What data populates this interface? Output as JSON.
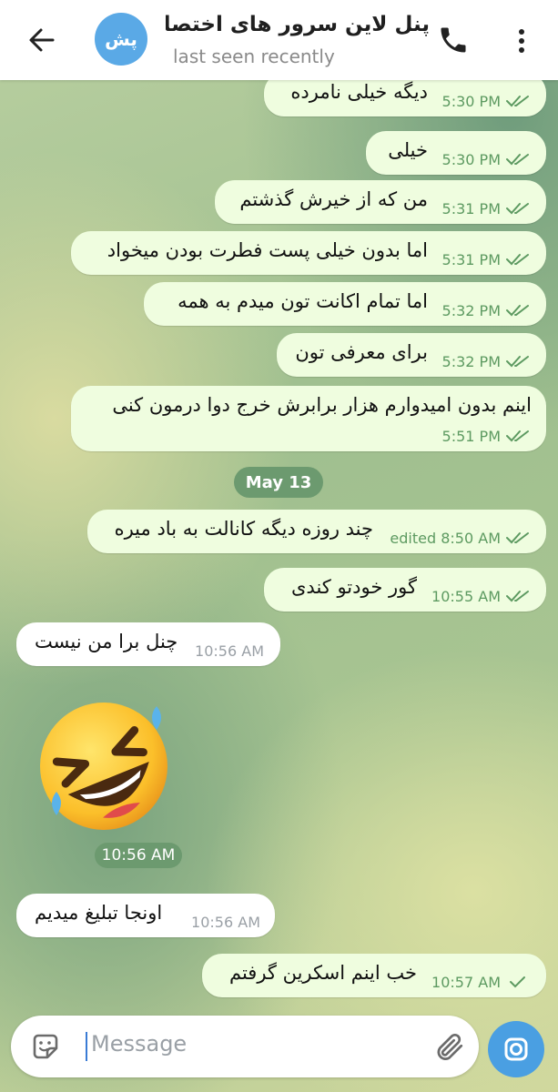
{
  "header": {
    "avatar_initials": "پش",
    "title": "پنل لاین سرور های اختصاصی",
    "subtitle": "last seen recently"
  },
  "messages": [
    {
      "text": "دیگه خیلی نامرده",
      "time": "5:30 PM",
      "direction": "out"
    },
    {
      "text": "خیلی",
      "time": "5:30 PM",
      "direction": "out"
    },
    {
      "text": "من که از خیرش گذشتم",
      "time": "5:31 PM",
      "direction": "out"
    },
    {
      "text": "اما بدون خیلی پست فطرت بودن میخواد",
      "time": "5:31 PM",
      "direction": "out"
    },
    {
      "text": "اما تمام اکانت تون میدم به همه",
      "time": "5:32 PM",
      "direction": "out"
    },
    {
      "text": "برای معرفی تون",
      "time": "5:32 PM",
      "direction": "out"
    },
    {
      "text": "اینم بدون امیدوارم هزار برابرش خرج دوا درمون کنی",
      "time": "5:51 PM",
      "direction": "out"
    },
    {
      "text": "چند روزه دیگه کانالت به باد میره",
      "time": "edited 8:50 AM",
      "direction": "out"
    },
    {
      "text": "گور خودتو کندی",
      "time": "10:55 AM",
      "direction": "out"
    },
    {
      "text": "چنل برا من نیست",
      "time": "10:56 AM",
      "direction": "in"
    },
    {
      "text": "اونجا تبلیغ میدیم",
      "time": "10:56 AM",
      "direction": "in"
    },
    {
      "text": "خب اینم اسکرین گرفتم",
      "time": "10:57 AM",
      "direction": "out"
    }
  ],
  "date_divider": "May 13",
  "emoji_message": {
    "emoji": "rolling-on-floor-laughing",
    "time": "10:56 AM"
  },
  "input": {
    "placeholder": "Message"
  },
  "colors": {
    "accent": "#4a9fe2",
    "outgoing_bubble": "#effddf",
    "incoming_bubble": "#ffffff",
    "tick_green": "#5d9a61",
    "date_pill": "#6c9a6f"
  },
  "icons": {
    "back": "arrow-left-icon",
    "call": "phone-icon",
    "menu": "more-vertical-icon",
    "sticker": "sticker-icon",
    "attach": "paperclip-icon",
    "camera": "camera-icon"
  }
}
